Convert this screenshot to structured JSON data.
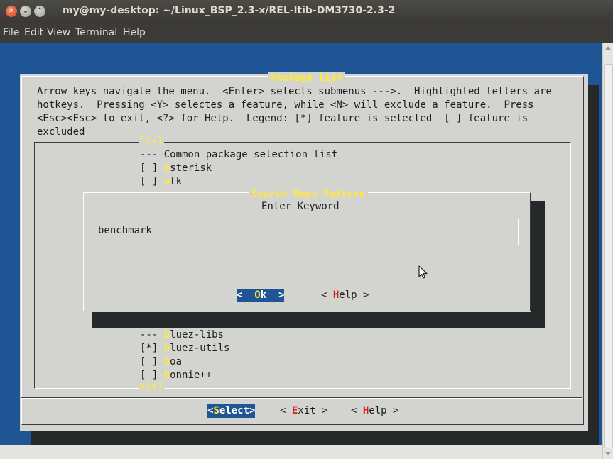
{
  "window": {
    "title": "my@my-desktop: ~/Linux_BSP_2.3-x/REL-ltib-DM3730-2.3-2",
    "close_glyph": "✕",
    "min_glyph": "⌄",
    "max_glyph": "⌃"
  },
  "menubar": [
    "File",
    "Edit",
    "View",
    "Terminal",
    "Help"
  ],
  "package_list": {
    "title": "Package list",
    "help_lines": [
      "Arrow keys navigate the menu.  <Enter> selects submenus --->.  Highlighted letters are",
      "hotkeys.  Pressing <Y> selectes a feature, while <N> will exclude a feature.  Press",
      "<Esc><Esc> to exit, <?> for Help.  Legend: [*] feature is selected  [ ] feature is",
      "excluded"
    ],
    "scroll_up_marker": "^(-)",
    "scroll_down_marker": "v(+)",
    "items_top": [
      {
        "prefix": "--- ",
        "hot": "",
        "rest": "Common package selection list"
      },
      {
        "prefix": "[ ] ",
        "hot": "a",
        "rest": "sterisk"
      },
      {
        "prefix": "[ ] ",
        "hot": "a",
        "rest": "tk"
      }
    ],
    "items_bottom": [
      {
        "prefix": "--- ",
        "hot": "b",
        "rest": "luez-libs"
      },
      {
        "prefix": "[*] ",
        "hot": "b",
        "rest": "luez-utils"
      },
      {
        "prefix": "[ ] ",
        "hot": "b",
        "rest": "oa"
      },
      {
        "prefix": "[ ] ",
        "hot": "b",
        "rest": "onnie++"
      }
    ],
    "buttons": {
      "select": {
        "pre": "<",
        "hot": "S",
        "post": "elect>"
      },
      "exit": {
        "pre": "< ",
        "hot": "E",
        "post": "xit >"
      },
      "help": {
        "pre": "< ",
        "hot": "H",
        "post": "elp >"
      }
    }
  },
  "search_dialog": {
    "title": "Search Menu Pattern",
    "label": "Enter Keyword",
    "input_value": "benchmark",
    "ok": {
      "pre": "<  ",
      "hot": "O",
      "post": "k  >"
    },
    "help": {
      "pre": "< ",
      "hot": "H",
      "post": "elp >"
    }
  },
  "colors": {
    "terminal_bg": "#1f5495",
    "dialog_bg": "#d3d3cf",
    "hotkey": "#ffea3c",
    "button_hotkey": "#d0201c"
  }
}
